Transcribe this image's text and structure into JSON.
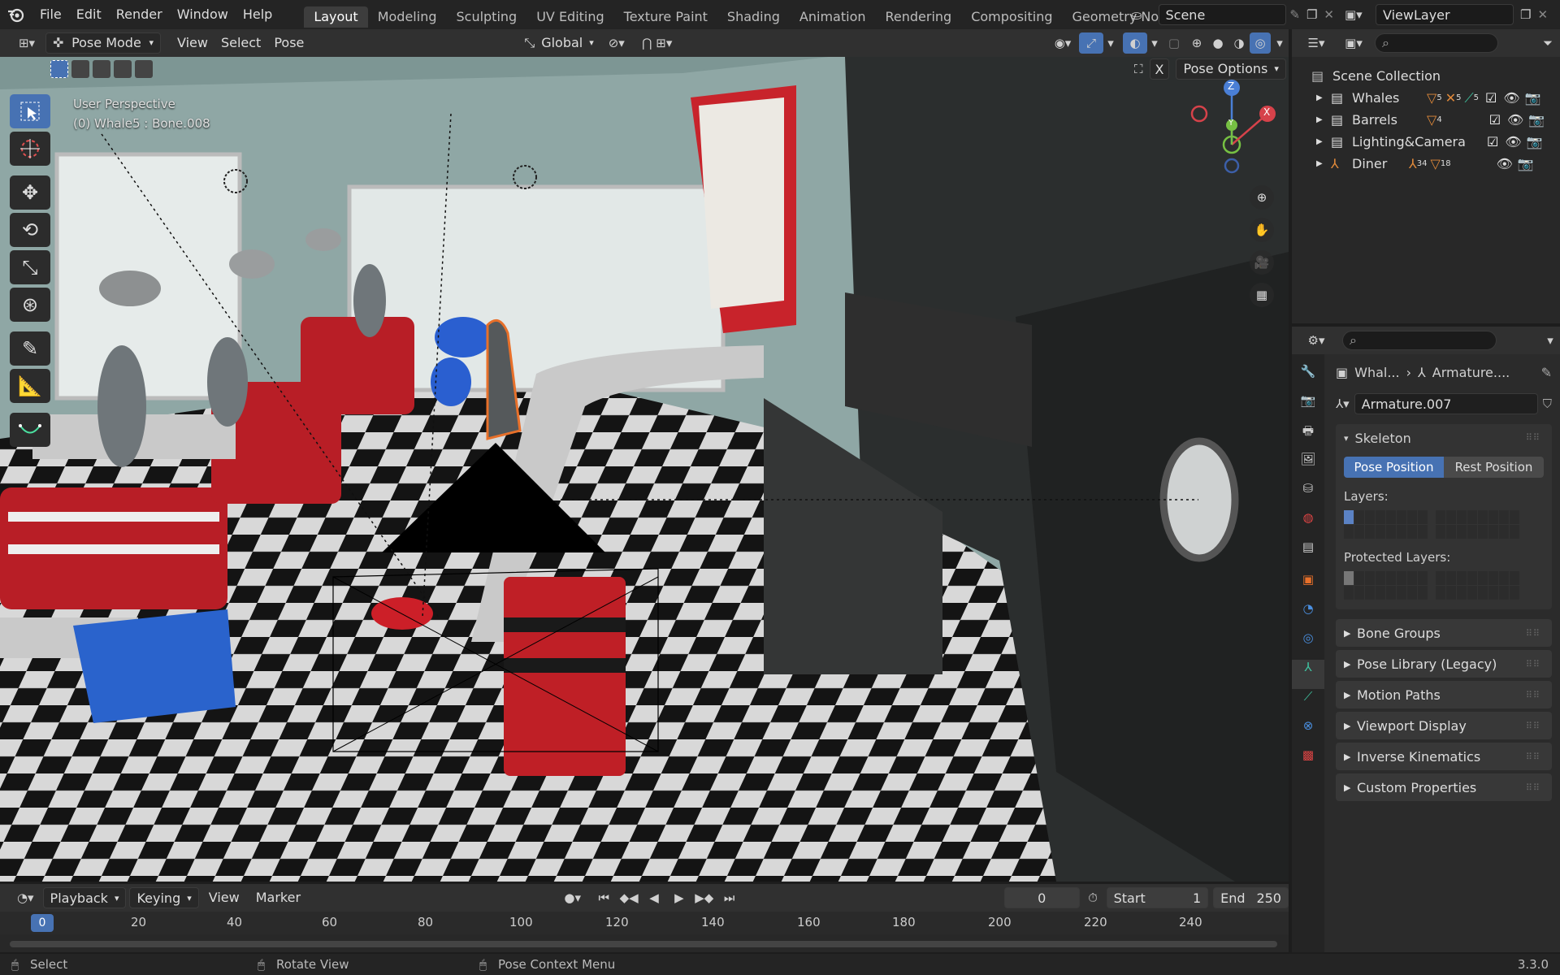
{
  "topbar": {
    "menus": [
      "File",
      "Edit",
      "Render",
      "Window",
      "Help"
    ],
    "workspaces": [
      "Layout",
      "Modeling",
      "Sculpting",
      "UV Editing",
      "Texture Paint",
      "Shading",
      "Animation",
      "Rendering",
      "Compositing",
      "Geometry Nodes"
    ],
    "active_workspace": "Layout",
    "scene": "Scene",
    "view_layer": "ViewLayer"
  },
  "viewport_header": {
    "mode": "Pose Mode",
    "menus": [
      "View",
      "Select",
      "Pose"
    ],
    "orientation": "Global",
    "pose_options": "Pose Options",
    "overlay_close": "X"
  },
  "viewport": {
    "perspective": "User Perspective",
    "active": "(0) Whale5 : Bone.008",
    "gizmo_axes": {
      "x": "X",
      "y": "Y",
      "z": "Z"
    }
  },
  "outliner": {
    "collection": "Scene Collection",
    "items": [
      {
        "name": "Whales",
        "badges": [
          "5",
          "5",
          "5"
        ]
      },
      {
        "name": "Barrels",
        "badges": [
          "4"
        ]
      },
      {
        "name": "Lighting&Camera",
        "badges": []
      },
      {
        "name": "Diner",
        "badges": [
          "34",
          "18"
        ]
      }
    ]
  },
  "properties": {
    "breadcrumb": [
      "Whal...",
      "Armature...."
    ],
    "data_name": "Armature.007",
    "skeleton": {
      "title": "Skeleton",
      "pose_position": "Pose Position",
      "rest_position": "Rest Position",
      "layers": "Layers:",
      "protected": "Protected Layers:"
    },
    "panels": [
      "Bone Groups",
      "Pose Library (Legacy)",
      "Motion Paths",
      "Viewport Display",
      "Inverse Kinematics",
      "Custom Properties"
    ]
  },
  "timeline": {
    "menus": [
      "Playback",
      "Keying",
      "View",
      "Marker"
    ],
    "current": "0",
    "start_label": "Start",
    "start": "1",
    "end_label": "End",
    "end": "250",
    "ticks": [
      "20",
      "40",
      "60",
      "80",
      "100",
      "120",
      "140",
      "160",
      "180",
      "200",
      "220",
      "240"
    ],
    "frame_indicator": "0"
  },
  "statusbar": {
    "select": "Select",
    "rotate": "Rotate View",
    "context": "Pose Context Menu",
    "version": "3.3.0"
  },
  "colors": {
    "accent": "#4772b3",
    "selection": "#e8702a",
    "red": "#c8232b"
  }
}
